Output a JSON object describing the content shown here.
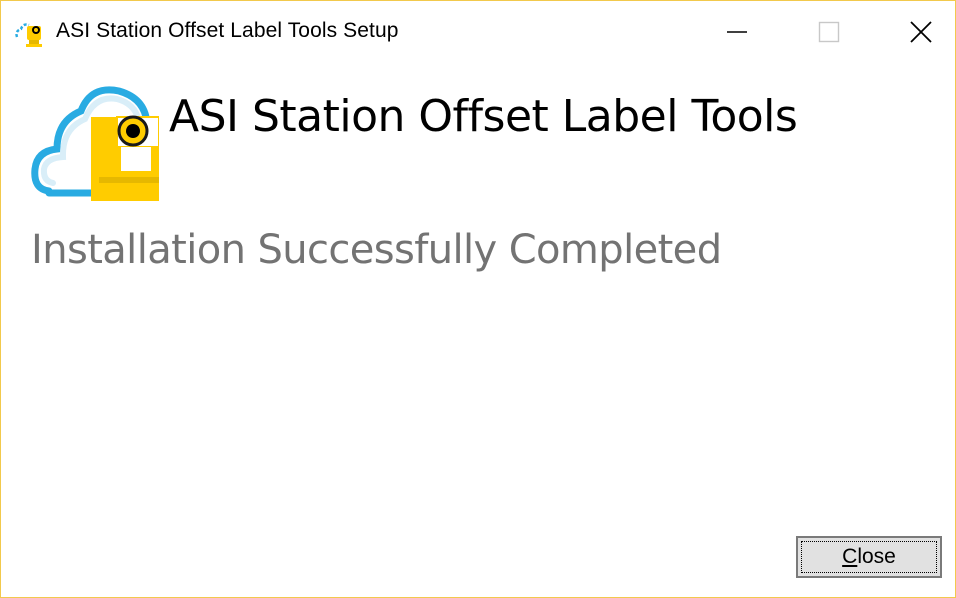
{
  "window": {
    "title": "ASI Station Offset Label Tools Setup",
    "controls": {
      "minimize": "minimize-icon",
      "maximize": "maximize-icon",
      "close": "close-icon"
    }
  },
  "header": {
    "product_title": "ASI Station Offset Label Tools",
    "logo": "surveying-instrument-cloud-logo"
  },
  "main": {
    "status": "Installation Successfully Completed"
  },
  "footer": {
    "close_label_access_key": "C",
    "close_label_rest": "lose"
  },
  "colors": {
    "window_border": "#f2c94c",
    "logo_blue": "#29abe2",
    "logo_yellow": "#ffcc00",
    "status_gray": "#737373",
    "button_face": "#e1e1e1"
  }
}
